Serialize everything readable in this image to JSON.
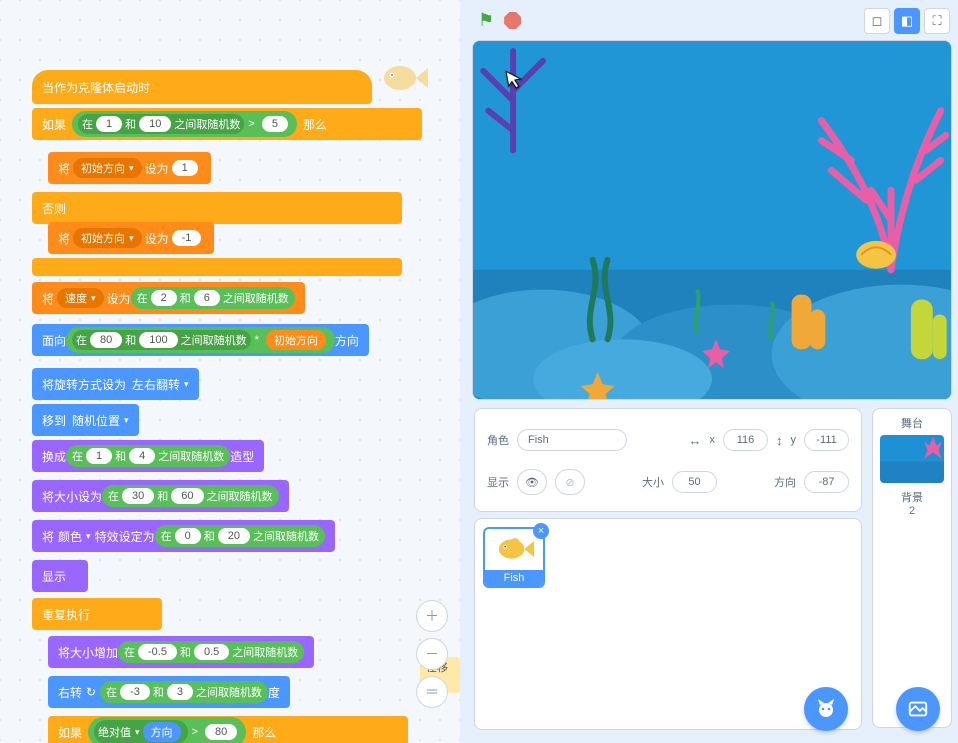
{
  "hat": "当作为克隆体启动时",
  "if_label": "如果",
  "then_label": "那么",
  "else_label": "否则",
  "rand_between": "之间取随机数",
  "and_label": "和",
  "in_label": "在",
  "gt": ">",
  "if_rand": {
    "a": "1",
    "b": "10",
    "cmp": "5"
  },
  "set_label": "将",
  "set_to": "设为",
  "var_initdir": "初始方向",
  "set1_val": "1",
  "setm1_val": "-1",
  "var_speed": "速度",
  "speed_rand": {
    "a": "2",
    "b": "6"
  },
  "point_label": "面向",
  "point_suffix": "方向",
  "point_rand": {
    "a": "80",
    "b": "100"
  },
  "mult": "*",
  "rot_label": "将旋转方式设为",
  "rot_mode": "左右翻转",
  "goto_label": "移到",
  "goto_target": "随机位置",
  "switch_label": "换成",
  "switch_suffix": "造型",
  "switch_rand": {
    "a": "1",
    "b": "4"
  },
  "setsize_label": "将大小设为",
  "setsize_rand": {
    "a": "30",
    "b": "60"
  },
  "effect_var": "颜色",
  "effect_label": "特效设定为",
  "effect_rand": {
    "a": "0",
    "b": "20"
  },
  "show": "显示",
  "forever": "重复执行",
  "changesize_label": "将大小增加",
  "changesize_rand": {
    "a": "-0.5",
    "b": "0.5"
  },
  "turn_label": "右转",
  "turn_suffix": "度",
  "turn_rand": {
    "a": "-3",
    "b": "3"
  },
  "abs_label": "绝对值",
  "abs_arg": "方向",
  "abs_cmp": "80",
  "edge_tag": "在移动",
  "sprite_panel": {
    "role": "角色",
    "name": "Fish",
    "x_lbl": "x",
    "x": "116",
    "y_lbl": "y",
    "y": "-111",
    "show_lbl": "显示",
    "size_lbl": "大小",
    "size": "50",
    "dir_lbl": "方向",
    "dir": "-87"
  },
  "stage_panel": {
    "title": "舞台",
    "bg_lbl": "背景",
    "bg_count": "2"
  },
  "sprite_item": "Fish"
}
